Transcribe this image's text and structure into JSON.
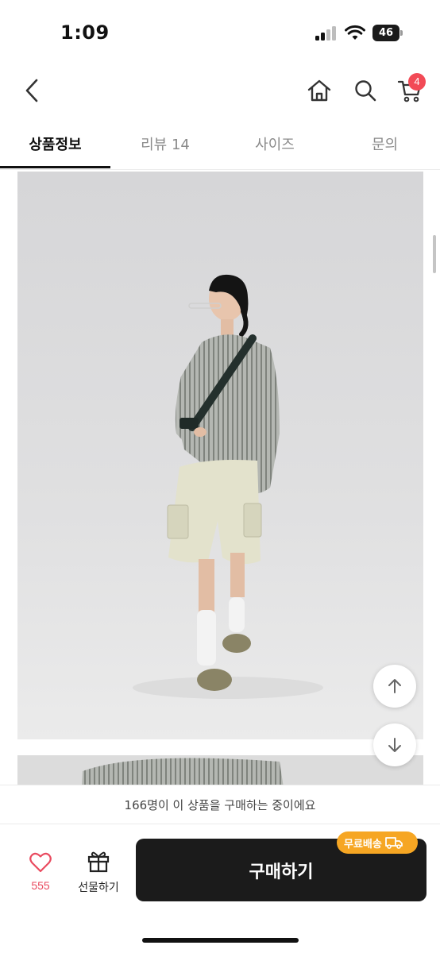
{
  "status_bar": {
    "time": "1:09",
    "battery": "46"
  },
  "nav": {
    "cart_count": "4"
  },
  "tabs": [
    {
      "label": "상품정보",
      "active": true
    },
    {
      "label": "리뷰 14",
      "active": false
    },
    {
      "label": "사이즈",
      "active": false
    },
    {
      "label": "문의",
      "active": false
    }
  ],
  "icons": {
    "back": "chevron-left-icon",
    "home": "home-icon",
    "search": "search-icon",
    "cart": "cart-icon",
    "scroll_up": "arrow-up-icon",
    "scroll_down": "arrow-down-icon",
    "like": "heart-icon",
    "gift": "gift-icon",
    "shipping": "truck-icon"
  },
  "notice": {
    "text": "166명이 이 상품을 구매하는 중이에요"
  },
  "bottom_bar": {
    "like_count": "555",
    "gift_label": "선물하기",
    "buy_label": "구매하기",
    "shipping_badge": "무료배송"
  },
  "colors": {
    "accent_red": "#f24a56",
    "like_pink": "#e94a5f",
    "buy_button": "#1b1b1b",
    "shipping_badge": "#f6a623"
  }
}
